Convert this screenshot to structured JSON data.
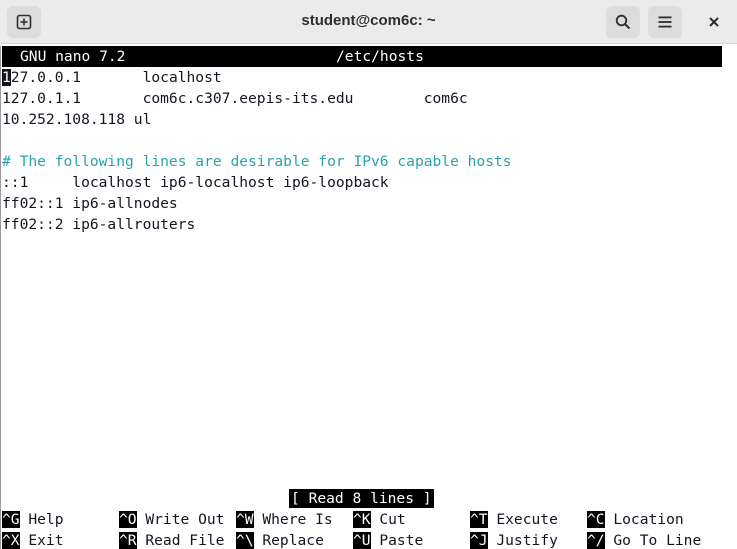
{
  "window": {
    "title": "student@com6c: ~"
  },
  "icons": {
    "new_tab": "new-tab-icon",
    "search": "search-icon",
    "menu": "hamburger-menu-icon",
    "close": "close-icon"
  },
  "nano": {
    "version": "GNU nano 7.2",
    "filename": "/etc/hosts",
    "lines": [
      {
        "text": "127.0.0.1       localhost",
        "type": "normal"
      },
      {
        "text": "127.0.1.1       com6c.c307.eepis-its.edu        com6c",
        "type": "normal"
      },
      {
        "text": "10.252.108.118 ul",
        "type": "normal"
      },
      {
        "text": "",
        "type": "normal"
      },
      {
        "text": "# The following lines are desirable for IPv6 capable hosts",
        "type": "comment"
      },
      {
        "text": "::1     localhost ip6-localhost ip6-loopback",
        "type": "normal"
      },
      {
        "text": "ff02::1 ip6-allnodes",
        "type": "normal"
      },
      {
        "text": "ff02::2 ip6-allrouters",
        "type": "normal"
      }
    ],
    "status": "[ Read 8 lines ]",
    "shortcuts_row1": [
      {
        "key": "^G",
        "label": "Help"
      },
      {
        "key": "^O",
        "label": "Write Out"
      },
      {
        "key": "^W",
        "label": "Where Is"
      },
      {
        "key": "^K",
        "label": "Cut"
      },
      {
        "key": "^T",
        "label": "Execute"
      },
      {
        "key": "^C",
        "label": "Location"
      }
    ],
    "shortcuts_row2": [
      {
        "key": "^X",
        "label": "Exit"
      },
      {
        "key": "^R",
        "label": "Read File"
      },
      {
        "key": "^\\",
        "label": "Replace"
      },
      {
        "key": "^U",
        "label": "Paste"
      },
      {
        "key": "^J",
        "label": "Justify"
      },
      {
        "key": "^/",
        "label": "Go To Line"
      }
    ]
  }
}
